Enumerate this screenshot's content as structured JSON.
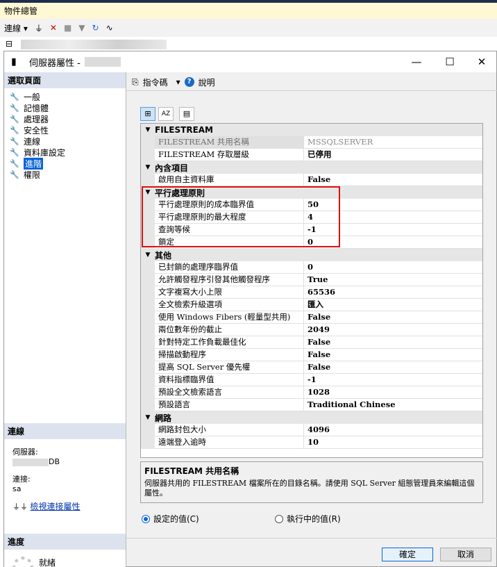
{
  "object_explorer": {
    "title": "物件總管",
    "toolbar": {
      "connect_label": "連線",
      "icons": [
        "plug-icon",
        "disconnect-icon",
        "stop-icon",
        "filter-icon",
        "refresh-icon",
        "activity-icon"
      ]
    },
    "tree_toggle": "⊟"
  },
  "dialog": {
    "title": "伺服器屬性 -",
    "controls": {
      "minimize": "—",
      "maximize": "☐",
      "close": "✕"
    }
  },
  "left_pane": {
    "select_page_header": "選取頁面",
    "pages": [
      {
        "label": "一般",
        "selected": false
      },
      {
        "label": "記憶體",
        "selected": false
      },
      {
        "label": "處理器",
        "selected": false
      },
      {
        "label": "安全性",
        "selected": false
      },
      {
        "label": "連線",
        "selected": false
      },
      {
        "label": "資料庫設定",
        "selected": false
      },
      {
        "label": "進階",
        "selected": true
      },
      {
        "label": "權限",
        "selected": false
      }
    ],
    "connection": {
      "header": "連線",
      "server_label": "伺服器:",
      "server_value": "DB",
      "login_label": "連接:",
      "login_value": "sa",
      "view_link": "檢視連接屬性"
    },
    "progress": {
      "header": "進度",
      "status": "就緒"
    }
  },
  "right_pane": {
    "toolbar": {
      "script_label": "指令碼",
      "help_label": "說明"
    },
    "grid_tools": {
      "categorized": "⊞",
      "alphabetical": "AZ",
      "property_pages": "▤"
    },
    "categories": [
      {
        "name": "FILESTREAM",
        "rows": [
          {
            "name": "FILESTREAM 共用名稱",
            "value": "MSSQLSERVER",
            "selected": true
          },
          {
            "name": "FILESTREAM 存取層級",
            "value": "已停用"
          }
        ]
      },
      {
        "name": "內含項目",
        "rows": [
          {
            "name": "啟用自主資料庫",
            "value": "False"
          }
        ]
      },
      {
        "name": "平行處理原則",
        "rows": [
          {
            "name": "平行處理原則的成本臨界值",
            "value": "50"
          },
          {
            "name": "平行處理原則的最大程度",
            "value": "4"
          },
          {
            "name": "查詢等候",
            "value": "-1"
          },
          {
            "name": "鎖定",
            "value": "0"
          }
        ]
      },
      {
        "name": "其他",
        "rows": [
          {
            "name": "已封鎖的處理序臨界值",
            "value": "0"
          },
          {
            "name": "允許觸發程序引發其他觸發程序",
            "value": "True"
          },
          {
            "name": "文字複寫大小上限",
            "value": "65536"
          },
          {
            "name": "全文檢索升級選項",
            "value": "匯入"
          },
          {
            "name": "使用 Windows Fibers (輕量型共用)",
            "value": "False"
          },
          {
            "name": "兩位數年份的截止",
            "value": "2049"
          },
          {
            "name": "針對特定工作負載最佳化",
            "value": "False"
          },
          {
            "name": "掃描啟動程序",
            "value": "False"
          },
          {
            "name": "提高 SQL Server 優先權",
            "value": "False"
          },
          {
            "name": "資料指標臨界值",
            "value": "-1"
          },
          {
            "name": "預設全文檢索語言",
            "value": "1028"
          },
          {
            "name": "預設語言",
            "value": "Traditional Chinese"
          }
        ]
      },
      {
        "name": "網路",
        "rows": [
          {
            "name": "網路封包大小",
            "value": "4096"
          },
          {
            "name": "遠端登入逾時",
            "value": "10"
          }
        ]
      }
    ],
    "description": {
      "title": "FILESTREAM 共用名稱",
      "text": "伺服器共用的 FILESTREAM 檔案所在的目錄名稱。請使用 SQL Server 組態管理員來編輯這個屬性。"
    },
    "view_options": [
      {
        "label": "設定的值(C)",
        "checked": true
      },
      {
        "label": "執行中的值(R)",
        "checked": false
      }
    ],
    "buttons": {
      "ok": "確定",
      "cancel": "取消"
    }
  },
  "colors": {
    "highlight": "#e01010",
    "selection": "#0a64d8",
    "category_bg": "#e6e6e6"
  }
}
